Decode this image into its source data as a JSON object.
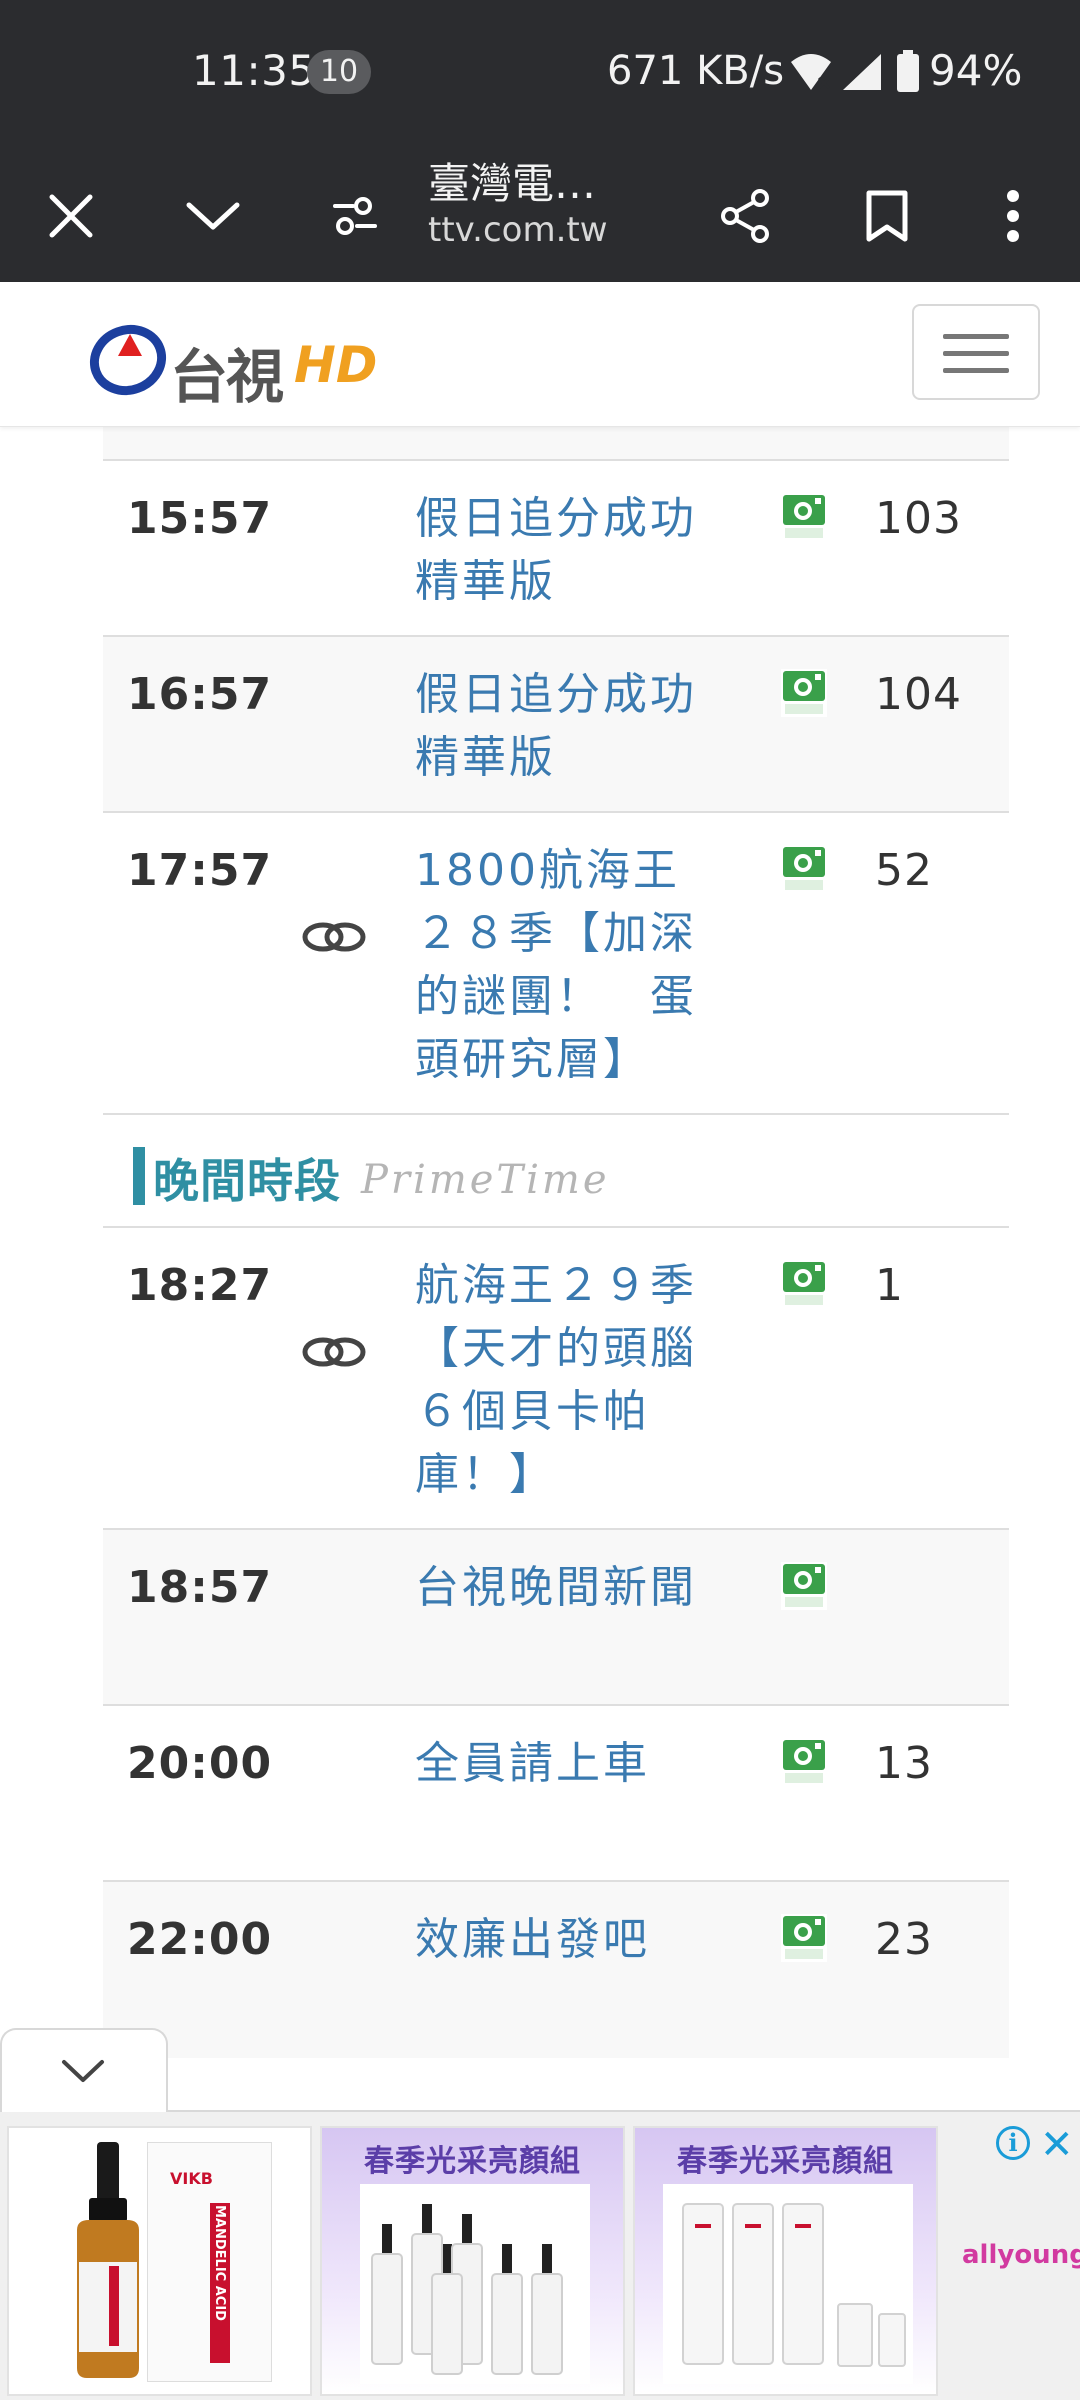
{
  "status_bar": {
    "time": "11:35",
    "notification_count": "10",
    "net_speed": "671 KB/s",
    "battery": "94%"
  },
  "browser": {
    "page_title": "臺灣電…",
    "url": "ttv.com.tw",
    "icons": [
      "close-icon",
      "chevron-down-icon",
      "site-settings-icon",
      "share-icon",
      "bookmark-icon",
      "more-vert-icon"
    ]
  },
  "site": {
    "logo_text": "台視",
    "logo_suffix": "HD",
    "menu_icon": "hamburger-icon"
  },
  "schedule": {
    "rows_before": [
      {
        "time": "15:57",
        "program": "假日追分成功精華版",
        "rating": "普遍級",
        "episode": "103",
        "replay": false
      },
      {
        "time": "16:57",
        "program": "假日追分成功精華版",
        "rating": "普遍級",
        "episode": "104",
        "replay": false
      },
      {
        "time": "17:57",
        "program": "1800航海王２８季【加深的謎團！　蛋頭研究層】",
        "rating": "普遍級",
        "episode": "52",
        "replay": true
      }
    ],
    "section": {
      "title": "晚間時段",
      "subtitle": "PrimeTime"
    },
    "rows_after": [
      {
        "time": "18:27",
        "program": "航海王２９季【天才的頭腦６個貝卡帕庫！】",
        "rating": "普遍級",
        "episode": "1",
        "replay": true
      },
      {
        "time": "18:57",
        "program": "台視晚間新聞",
        "rating": "普遍級",
        "episode": "",
        "replay": false
      },
      {
        "time": "20:00",
        "program": "全員請上車",
        "rating": "普遍級",
        "episode": "13",
        "replay": false
      },
      {
        "time": "22:00",
        "program": "效廉出發吧",
        "rating": "普遍級",
        "episode": "23",
        "replay": false
      }
    ]
  },
  "ad": {
    "collapse_icon": "chevron-down-icon",
    "product_brand": "VIKB",
    "product_label": "MANDELIC ACID",
    "promo_1": "春季光采亮顏組",
    "promo_2": "春季光采亮顏組",
    "network": "allyoung",
    "info_glyph": "i",
    "close_glyph": "✕"
  },
  "colors": {
    "chrome_bg": "#2b2c2f",
    "program_link": "#3a7ab0",
    "rating_green": "#3aa04a",
    "section_teal": "#2f8fa3",
    "row_alt_bg": "#f8f8f8"
  }
}
